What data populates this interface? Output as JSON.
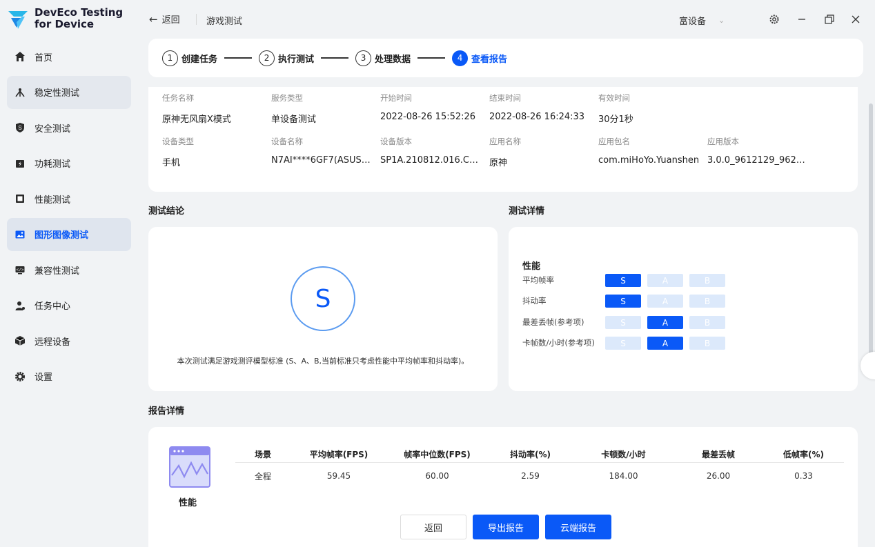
{
  "app": {
    "title_line1": "DevEco Testing",
    "title_line2": "for Device"
  },
  "sidebar": {
    "items": [
      {
        "label": "首页",
        "icon": "home-icon"
      },
      {
        "label": "稳定性测试",
        "icon": "stability-icon"
      },
      {
        "label": "安全测试",
        "icon": "shield-icon"
      },
      {
        "label": "功耗测试",
        "icon": "power-icon"
      },
      {
        "label": "性能测试",
        "icon": "performance-icon"
      },
      {
        "label": "图形图像测试",
        "icon": "image-icon"
      },
      {
        "label": "兼容性测试",
        "icon": "compat-icon"
      },
      {
        "label": "任务中心",
        "icon": "user-task-icon"
      },
      {
        "label": "远程设备",
        "icon": "remote-device-icon"
      },
      {
        "label": "设置",
        "icon": "gear-icon"
      }
    ],
    "active_index": 5
  },
  "header": {
    "back_label": "返回",
    "breadcrumb": "游戏测试",
    "device_select": "富设备"
  },
  "stepper": {
    "steps": [
      {
        "num": "1",
        "label": "创建任务"
      },
      {
        "num": "2",
        "label": "执行测试"
      },
      {
        "num": "3",
        "label": "处理数据"
      },
      {
        "num": "4",
        "label": "查看报告"
      }
    ],
    "current": 4
  },
  "task_info": {
    "row1": [
      {
        "key": "任务名称",
        "value": "原神无风扇X模式"
      },
      {
        "key": "服务类型",
        "value": "单设备测试"
      },
      {
        "key": "开始时间",
        "value": "2022-08-26 15:52:26"
      },
      {
        "key": "结束时间",
        "value": "2022-08-26 16:24:33"
      },
      {
        "key": "有效时间",
        "value": "30分1秒"
      }
    ],
    "row2": [
      {
        "key": "设备类型",
        "value": "手机"
      },
      {
        "key": "设备名称",
        "value": "N7AI****6GF7(ASUS…"
      },
      {
        "key": "设备版本",
        "value": "SP1A.210812.016.C…"
      },
      {
        "key": "应用名称",
        "value": "原神"
      },
      {
        "key": "应用包名",
        "value": "com.miHoYo.Yuanshen"
      },
      {
        "key": "应用版本",
        "value": "3.0.0_9612129_962…"
      }
    ]
  },
  "conclusion": {
    "title": "测试结论",
    "grade": "S",
    "note": "本次测试满足游戏测评模型标准 (S、A、B,当前标准只考虑性能中平均帧率和抖动率)。"
  },
  "details": {
    "title": "测试详情",
    "section": "性能",
    "grade_labels": [
      "S",
      "A",
      "B"
    ],
    "metrics": [
      {
        "label": "平均帧率",
        "grade": "S"
      },
      {
        "label": "抖动率",
        "grade": "S"
      },
      {
        "label": "最差丢帧(参考项)",
        "grade": "A"
      },
      {
        "label": "卡帧数/小时(参考项)",
        "grade": "A"
      }
    ]
  },
  "report": {
    "title": "报告详情",
    "category_label": "性能",
    "columns": [
      "场景",
      "平均帧率(FPS)",
      "帧率中位数(FPS)",
      "抖动率(%)",
      "卡顿数/小时",
      "最差丢帧",
      "低帧率(%)"
    ],
    "rows": [
      [
        "全程",
        "59.45",
        "60.00",
        "2.59",
        "184.00",
        "26.00",
        "0.33"
      ]
    ]
  },
  "footer": {
    "back": "返回",
    "export": "导出报告",
    "cloud": "云端报告"
  },
  "colors": {
    "accent": "#0a59f7",
    "chip_inactive": "#dce9fb",
    "sidebar_bg": "#f1f3f5"
  }
}
